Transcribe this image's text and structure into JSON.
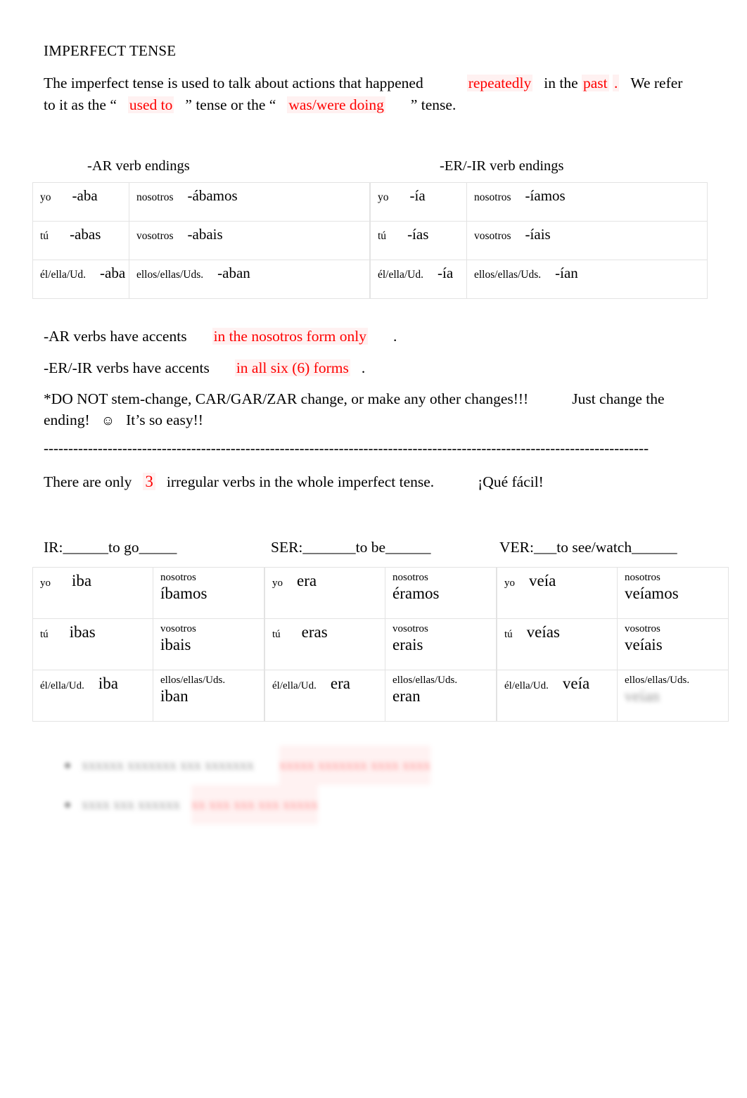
{
  "document": {
    "title": "IMPERFECT TENSE",
    "intro": {
      "part1": "The imperfect tense is used to talk about actions that happened",
      "hl_repeatedly": "repeatedly",
      "part2": "in the",
      "hl_past": "past",
      "part3": ".",
      "part4": "We refer to it as the “",
      "hl_used_to": "used to",
      "part5": "” tense or the “",
      "hl_was_were_doing": "was/were doing",
      "part6": "” tense."
    }
  },
  "endings": {
    "ar": {
      "caption": "-AR verb endings",
      "rows": [
        {
          "left_pron": "yo",
          "left_form": "-aba",
          "right_pron": "nosotros",
          "right_form": "-ábamos"
        },
        {
          "left_pron": "tú",
          "left_form": "-abas",
          "right_pron": "vosotros",
          "right_form": "-abais"
        },
        {
          "left_pron": "él/ella/Ud.",
          "left_form": "-aba",
          "right_pron": "ellos/ellas/Uds.",
          "right_form": "-aban"
        }
      ]
    },
    "erir": {
      "caption": "-ER/-IR verb endings",
      "rows": [
        {
          "left_pron": "yo",
          "left_form": "-ía",
          "right_pron": "nosotros",
          "right_form": "-íamos"
        },
        {
          "left_pron": "tú",
          "left_form": "-ías",
          "right_pron": "vosotros",
          "right_form": "-íais"
        },
        {
          "left_pron": "él/ella/Ud.",
          "left_form": "-ía",
          "right_pron": "ellos/ellas/Uds.",
          "right_form": "-ían"
        }
      ]
    }
  },
  "notes": {
    "ar_accent_label": "-AR verbs have accents",
    "ar_accent_answer": "in the nosotros form only",
    "ar_accent_period": ".",
    "erir_accent_label": "-ER/-IR verbs have accents",
    "erir_accent_answer": "in all six (6) forms",
    "erir_accent_period": ".",
    "warning_line1": "*DO NOT stem-change, CAR/GAR/ZAR change, or make any other changes!!!",
    "warning_line1b": "Just change the",
    "warning_line2a": "ending!",
    "warning_smiley": "☺",
    "warning_line2b": "It’s so easy!!"
  },
  "divider": {
    "dashes": "---------------------------------------------------------------------------------------------------------------------------"
  },
  "irregulars_intro": {
    "before": "There are only",
    "count": "3",
    "after": "irregular verbs in the whole imperfect tense.",
    "exclaim": "¡Qué fácil!"
  },
  "irregular_verbs": [
    {
      "heading": "IR:______to go_____",
      "rows": [
        {
          "left_pron": "yo",
          "left_form": "iba",
          "right_pron": "nosotros",
          "right_form": "íbamos"
        },
        {
          "left_pron": "tú",
          "left_form": "ibas",
          "right_pron": "vosotros",
          "right_form": "ibais"
        },
        {
          "left_pron": "él/ella/Ud.",
          "left_form": "iba",
          "right_pron": "ellos/ellas/Uds.",
          "right_form": "iban"
        }
      ]
    },
    {
      "heading": "SER:_______to be______",
      "rows": [
        {
          "left_pron": "yo",
          "left_form": "era",
          "right_pron": "nosotros",
          "right_form": "éramos"
        },
        {
          "left_pron": "tú",
          "left_form": "eras",
          "right_pron": "vosotros",
          "right_form": "erais"
        },
        {
          "left_pron": "él/ella/Ud.",
          "left_form": "era",
          "right_pron": "ellos/ellas/Uds.",
          "right_form": "eran"
        }
      ]
    },
    {
      "heading": "VER:___to see/watch______",
      "rows": [
        {
          "left_pron": "yo",
          "left_form": "veía",
          "right_pron": "nosotros",
          "right_form": "veíamos"
        },
        {
          "left_pron": "tú",
          "left_form": "veías",
          "right_pron": "vosotros",
          "right_form": "veíais"
        },
        {
          "left_pron": "él/ella/Ud.",
          "left_form": "veía",
          "right_pron": "ellos/ellas/Uds.",
          "right_form": "veían"
        }
      ]
    }
  ],
  "bottom_obscured": {
    "line1_black": "xxxxxx xxxxxxx xxx xxxxxxx",
    "line1_red": "xxxxx xxxxxxx xxxx xxxx",
    "line2_black": "xxxx xxx xxxxxx",
    "line2_red": "xx xxx xxx xxx xxxxx"
  }
}
